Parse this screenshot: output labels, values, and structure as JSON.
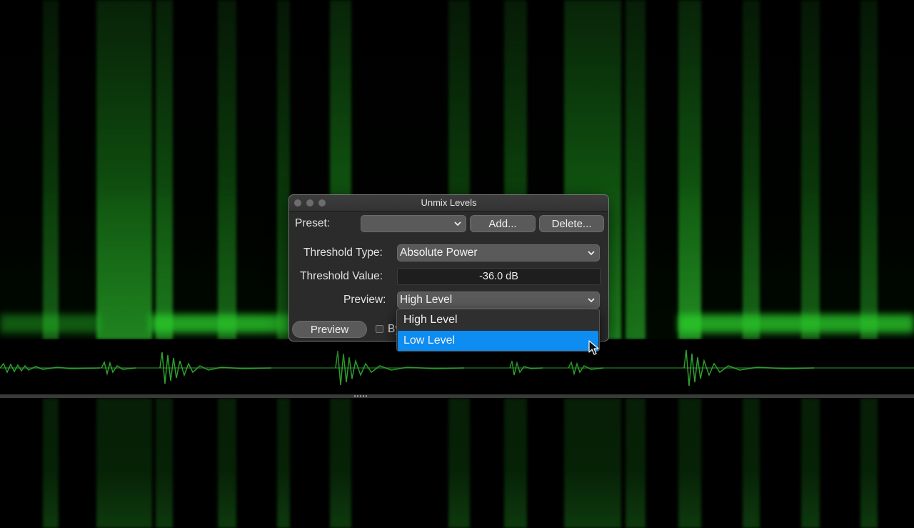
{
  "dialog": {
    "title": "Unmix Levels",
    "preset_label": "Preset:",
    "preset_value": "",
    "add_label": "Add...",
    "delete_label": "Delete...",
    "threshold_type_label": "Threshold Type:",
    "threshold_type_value": "Absolute Power",
    "threshold_value_label": "Threshold Value:",
    "threshold_value": "-36.0 dB",
    "preview_label": "Preview:",
    "preview_value": "High Level",
    "preview_button": "Preview",
    "bypass_label": "By"
  },
  "dropdown": {
    "options": [
      "High Level",
      "Low Level"
    ],
    "selected": "Low Level"
  },
  "colors": {
    "accent": "#0d8cf2",
    "spectrum": "#3ccf3c",
    "dialog_bg": "#2b2b2b"
  },
  "icons": {
    "chevron": "chevron-down-icon",
    "cursor": "hand-pointer-icon"
  }
}
